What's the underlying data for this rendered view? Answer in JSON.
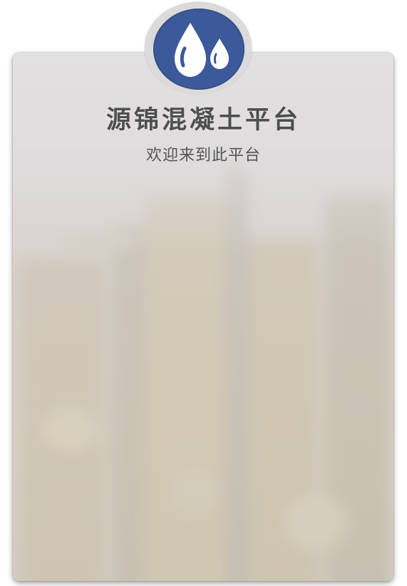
{
  "app": {
    "title": "源锦混凝土平台",
    "subtitle": "欢迎来到此平台"
  },
  "logo": {
    "icon": "water-drops-icon",
    "color": "#3c5a99"
  },
  "background": {
    "description_icon": "blurred-city-skyline"
  }
}
